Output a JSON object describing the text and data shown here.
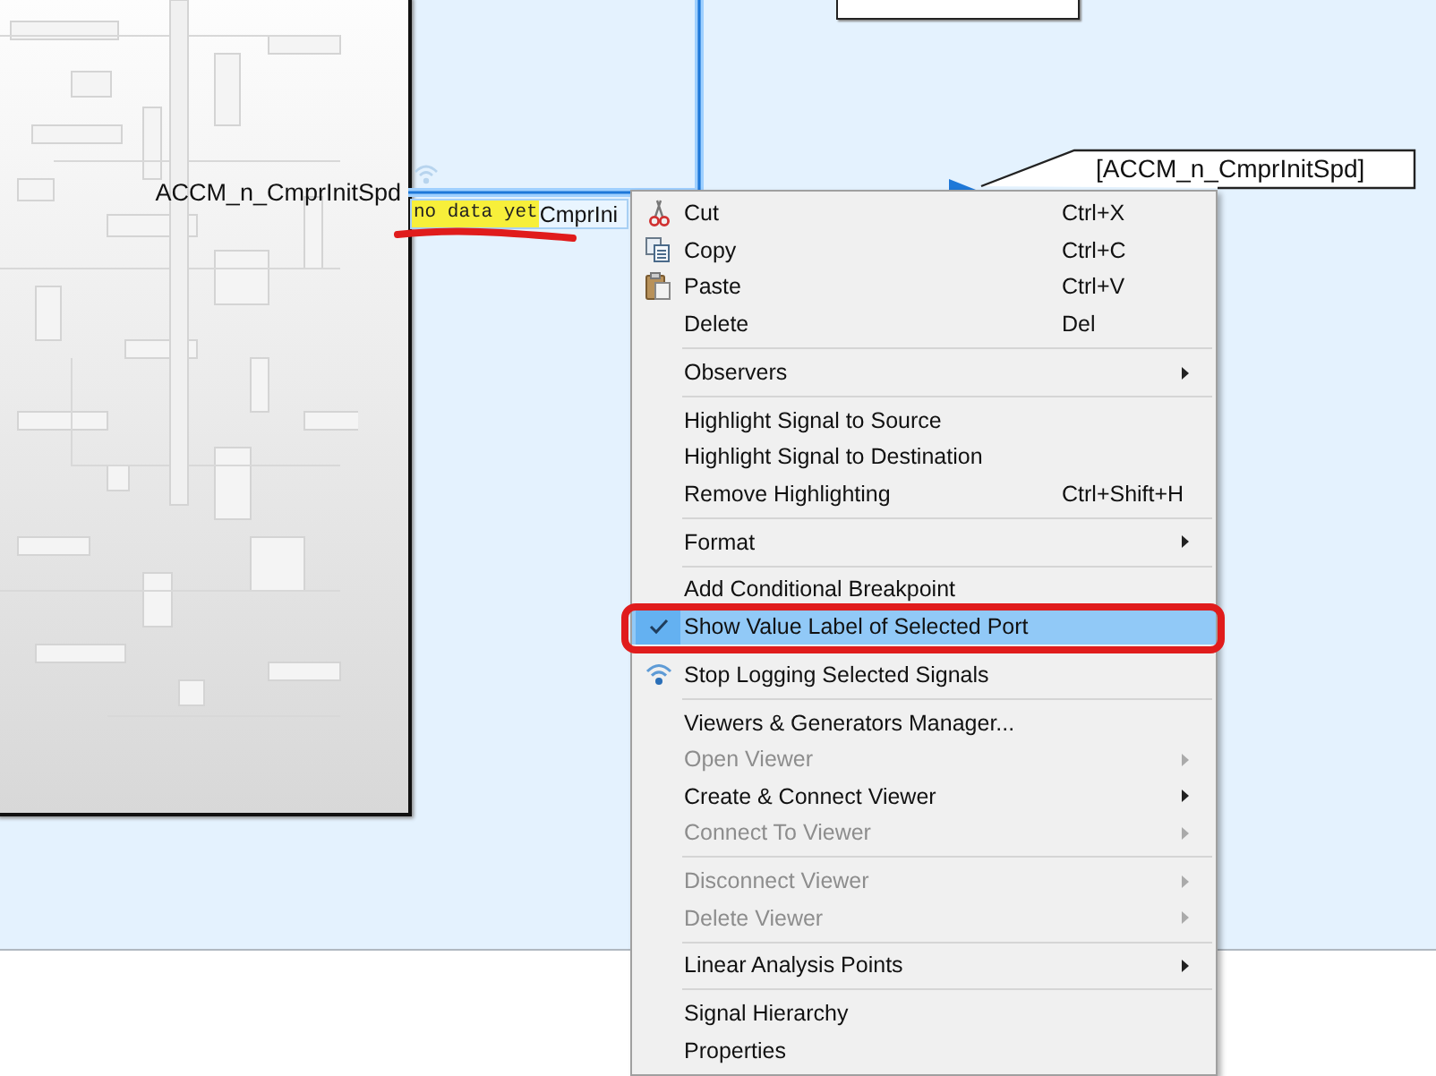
{
  "diagram": {
    "subsystem": {
      "port_label": "ACCM_n_CmprInitSpd"
    },
    "signal": {
      "logging": true,
      "selected": true,
      "value_label": "no data yet",
      "name_label": "CmprIni"
    },
    "goto_block": {
      "tag": "[ACCM_n_CmprInitSpd]"
    }
  },
  "context_menu": {
    "sections": [
      {
        "items": [
          {
            "label": "Cut",
            "shortcut": "Ctrl+X",
            "kind": "action",
            "disabled": false,
            "selected": false
          },
          {
            "label": "Copy",
            "shortcut": "Ctrl+C",
            "kind": "action",
            "disabled": false,
            "selected": false
          },
          {
            "label": "Paste",
            "shortcut": "Ctrl+V",
            "kind": "action",
            "disabled": false,
            "selected": false
          },
          {
            "label": "Delete",
            "shortcut": "Del",
            "kind": "action",
            "disabled": false,
            "selected": false
          }
        ]
      },
      {
        "items": [
          {
            "label": "Observers",
            "kind": "submenu",
            "disabled": false,
            "selected": false
          }
        ]
      },
      {
        "items": [
          {
            "label": "Highlight Signal to Source",
            "kind": "action",
            "disabled": false,
            "selected": false
          },
          {
            "label": "Highlight Signal to Destination",
            "kind": "action",
            "disabled": false,
            "selected": false
          },
          {
            "label": "Remove Highlighting",
            "shortcut": "Ctrl+Shift+H",
            "kind": "action",
            "disabled": false,
            "selected": false
          }
        ]
      },
      {
        "items": [
          {
            "label": "Format",
            "kind": "submenu",
            "disabled": false,
            "selected": false
          }
        ]
      },
      {
        "items": [
          {
            "label": "Add Conditional Breakpoint",
            "kind": "action",
            "disabled": false,
            "selected": false
          },
          {
            "label": "Show Value Label of Selected Port",
            "kind": "toggle",
            "checked": true,
            "disabled": false,
            "selected": true
          }
        ]
      },
      {
        "items": [
          {
            "label": "Stop Logging Selected Signals",
            "kind": "action",
            "disabled": false,
            "selected": false
          }
        ]
      },
      {
        "items": [
          {
            "label": "Viewers & Generators Manager...",
            "kind": "action",
            "disabled": false,
            "selected": false
          },
          {
            "label": "Open Viewer",
            "kind": "submenu",
            "disabled": true,
            "selected": false
          },
          {
            "label": "Create & Connect Viewer",
            "kind": "submenu",
            "disabled": false,
            "selected": false
          },
          {
            "label": "Connect To Viewer",
            "kind": "submenu",
            "disabled": true,
            "selected": false
          }
        ]
      },
      {
        "items": [
          {
            "label": "Disconnect Viewer",
            "kind": "submenu",
            "disabled": true,
            "selected": false
          },
          {
            "label": "Delete Viewer",
            "kind": "submenu",
            "disabled": true,
            "selected": false
          }
        ]
      },
      {
        "items": [
          {
            "label": "Linear Analysis Points",
            "kind": "submenu",
            "disabled": false,
            "selected": false
          }
        ]
      },
      {
        "items": [
          {
            "label": "Signal Hierarchy",
            "kind": "action",
            "disabled": false,
            "selected": false
          },
          {
            "label": "Properties",
            "kind": "action",
            "disabled": false,
            "selected": false
          }
        ]
      }
    ]
  }
}
